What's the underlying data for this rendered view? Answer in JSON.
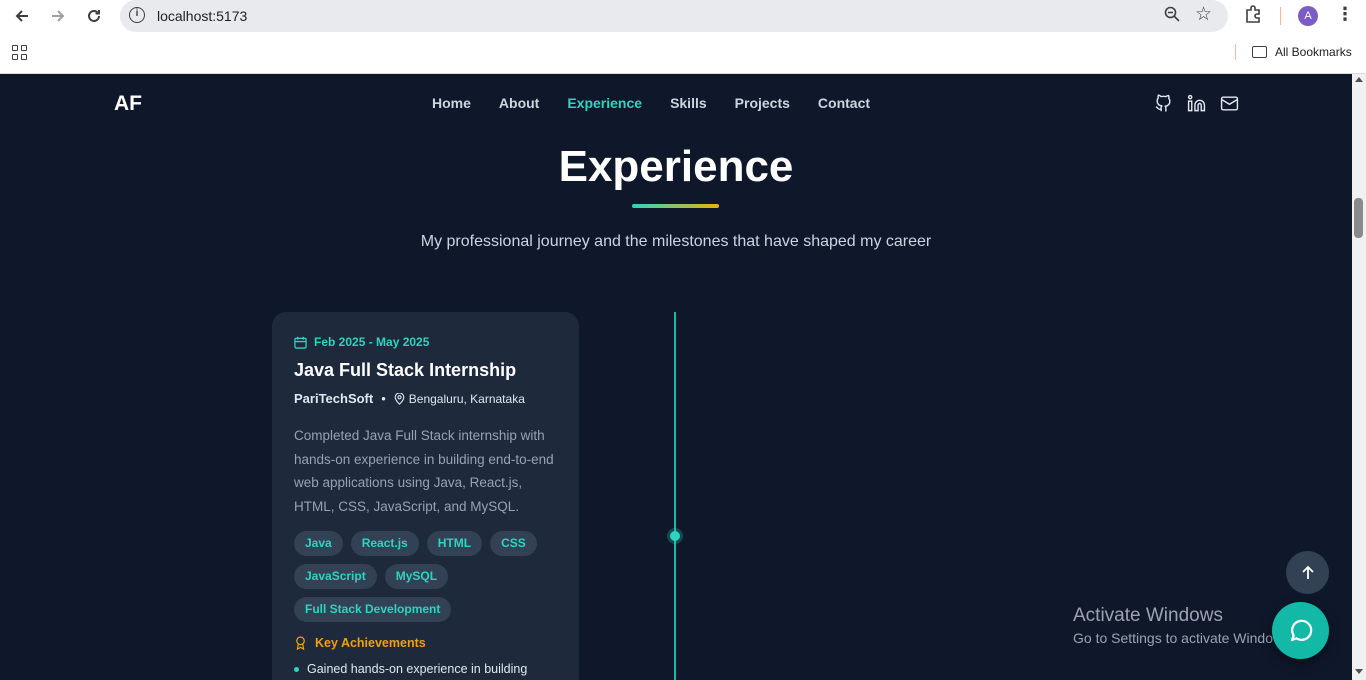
{
  "browser": {
    "url": "localhost:5173",
    "profile_initial": "A",
    "bookmarks_label": "All Bookmarks"
  },
  "header": {
    "logo": "AF",
    "nav": [
      "Home",
      "About",
      "Experience",
      "Skills",
      "Projects",
      "Contact"
    ],
    "active_nav": "Experience",
    "socials": [
      "github-icon",
      "linkedin-icon",
      "mail-icon"
    ]
  },
  "section": {
    "title": "Experience",
    "subtitle": "My professional journey and the milestones that have shaped my career"
  },
  "experience": {
    "date": "Feb 2025 - May 2025",
    "title": "Java Full Stack Internship",
    "company": "PariTechSoft",
    "separator": "•",
    "location": "Bengaluru, Karnataka",
    "description": "Completed Java Full Stack internship with hands-on experience in building end-to-end web applications using Java, React.js, HTML, CSS, JavaScript, and MySQL.",
    "tags": [
      "Java",
      "React.js",
      "HTML",
      "CSS",
      "JavaScript",
      "MySQL",
      "Full Stack Development"
    ],
    "achievements_heading": "Key Achievements",
    "achievements": [
      "Gained hands-on experience in building"
    ]
  },
  "overlay": {
    "activate_title": "Activate Windows",
    "activate_sub": "Go to Settings to activate Windows."
  },
  "colors": {
    "background": "#0f172a",
    "card": "#1e293b",
    "accent": "#2dd4bf",
    "achievement": "#f59e0b"
  }
}
